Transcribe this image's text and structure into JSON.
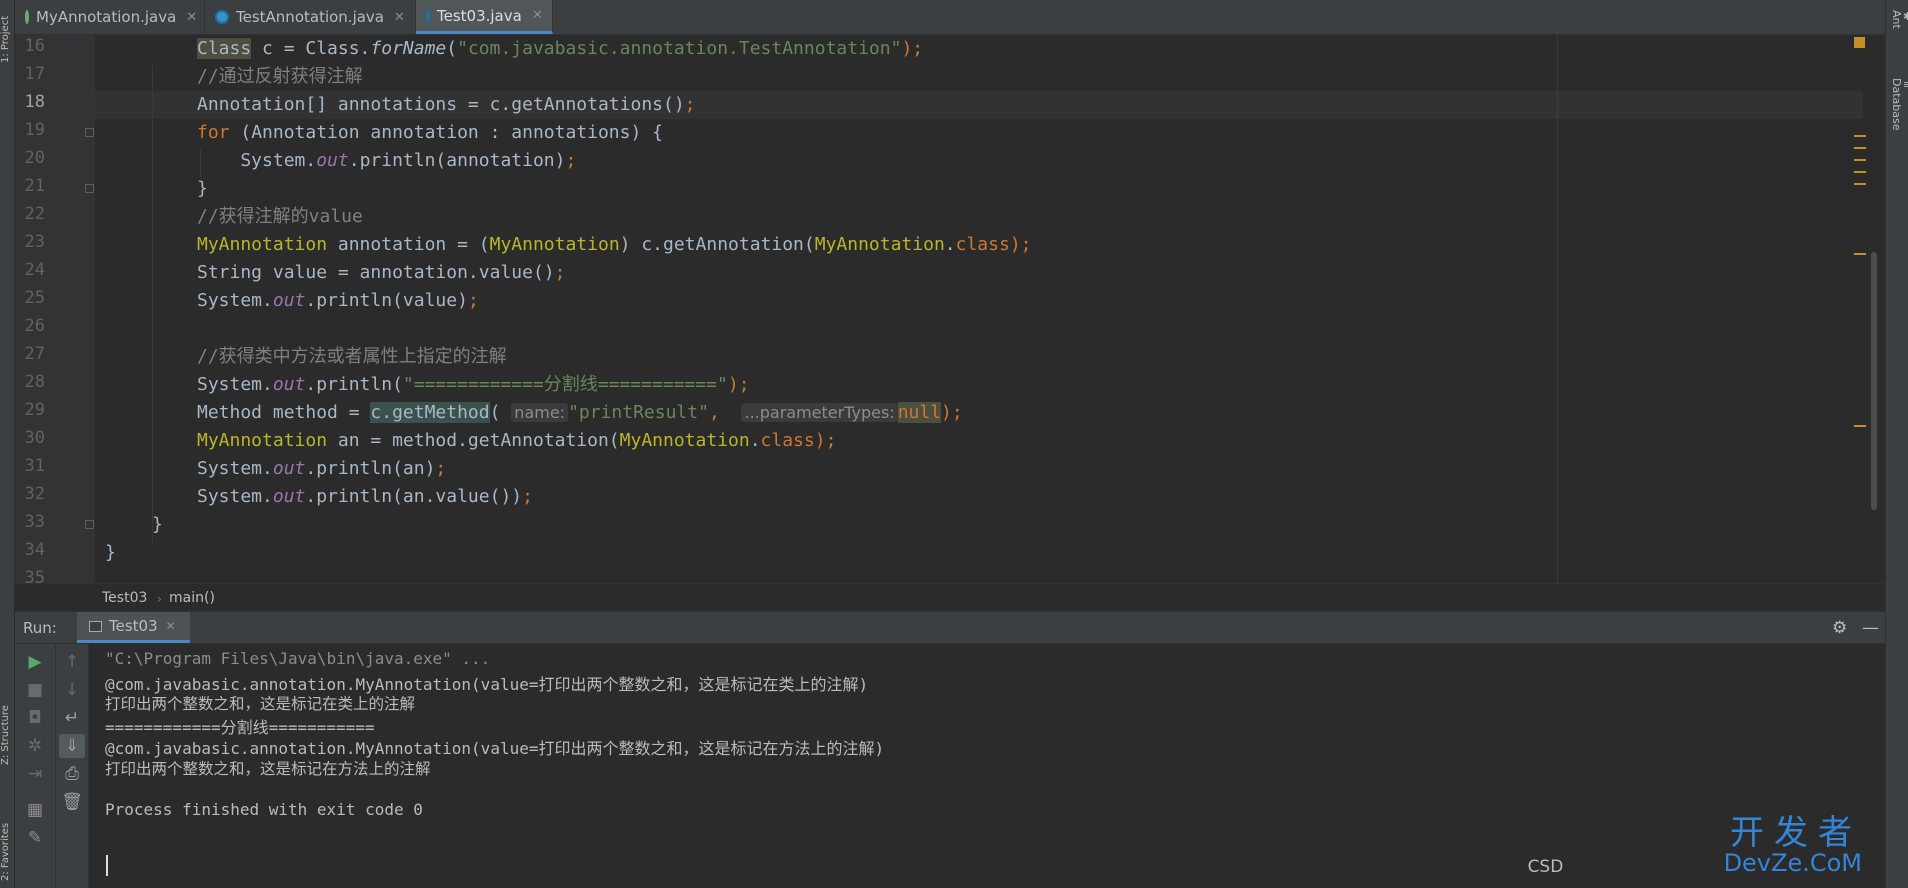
{
  "tool_windows": {
    "left": [
      "1: Project",
      "Z: Structure",
      "2: Favorites"
    ],
    "right": [
      "Ant",
      "Database"
    ]
  },
  "tabs": [
    {
      "label": "MyAnnotation.java",
      "icon": "annotation-file-icon",
      "active": false
    },
    {
      "label": "TestAnnotation.java",
      "icon": "class-file-icon",
      "active": false
    },
    {
      "label": "Test03.java",
      "icon": "class-file-icon",
      "active": true
    }
  ],
  "editor": {
    "line_numbers": [
      "16",
      "17",
      "18",
      "19",
      "20",
      "21",
      "22",
      "23",
      "24",
      "25",
      "26",
      "27",
      "28",
      "29",
      "30",
      "31",
      "32",
      "33",
      "34",
      "35"
    ],
    "current_line": "18",
    "lines": {
      "l16": {
        "a": "Class",
        "b": " c = Class.",
        "c": "forName",
        "d": "(",
        "e": "\"com.javabasic.annotation.TestAnnotation\"",
        "f": ");"
      },
      "l17": "//通过反射获得注解",
      "l18": {
        "a": "Annotation[] annotations = c.getAnnotations()",
        "b": ";"
      },
      "l19": {
        "a": "for",
        "b": " (Annotation annotation : annotations) {"
      },
      "l20": {
        "a": "    System.",
        "b": "out",
        "c": ".println(annotation)",
        "d": ";"
      },
      "l21": "}",
      "l22": "//获得注解的value",
      "l23": {
        "a": "MyAnnotation",
        "b": " annotation = (",
        "c": "MyAnnotation",
        "d": ") c.getAnnotation(",
        "e": "MyAnnotation",
        "f": ".",
        "g": "class",
        "h": ");"
      },
      "l24": {
        "a": "String value = annotation.value()",
        "b": ";"
      },
      "l25": {
        "a": "System.",
        "b": "out",
        "c": ".println(value)",
        "d": ";"
      },
      "l26": "",
      "l27": "//获得类中方法或者属性上指定的注解",
      "l28": {
        "a": "System.",
        "b": "out",
        "c": ".println(",
        "d": "\"============分割线===========\"",
        "e": ");"
      },
      "l29": {
        "a": "Method method = ",
        "b": "c.getMethod",
        "c": "(",
        "d": "name:",
        "e": "\"printResult\"",
        "f": ", ",
        "g": "...parameterTypes:",
        "h": "null",
        "i": ");"
      },
      "l30": {
        "a": "MyAnnotation",
        "b": " an = method.getAnnotation(",
        "c": "MyAnnotation",
        "d": ".",
        "e": "class",
        "f": ");"
      },
      "l31": {
        "a": "System.",
        "b": "out",
        "c": ".println(an)",
        "d": ";"
      },
      "l32": {
        "a": "System.",
        "b": "out",
        "c": ".println(an.value())",
        "d": ";"
      },
      "l33": "}",
      "l34": "}"
    }
  },
  "breadcrumb": {
    "class": "Test03",
    "method": "main()"
  },
  "run": {
    "label": "Run:",
    "tab_label": "Test03",
    "console": [
      "\"C:\\Program Files\\Java\\bin\\java.exe\" ...",
      "@com.javabasic.annotation.MyAnnotation(value=打印出两个整数之和，这是标记在类上的注解)",
      "打印出两个整数之和，这是标记在类上的注解",
      "============分割线===========",
      "@com.javabasic.annotation.MyAnnotation(value=打印出两个整数之和，这是标记在方法上的注解)",
      "打印出两个整数之和，这是标记在方法上的注解",
      "",
      "Process finished with exit code 0"
    ]
  },
  "watermark": {
    "big": "开发者",
    "small": "DevZe.CoM",
    "prefix": "CSD"
  },
  "colors": {
    "background": "#2b2b2b",
    "keyword": "#cc7832",
    "string": "#6a8759",
    "comment": "#808080",
    "annotation": "#bbb529",
    "field": "#9876aa",
    "accent": "#4a88c7"
  }
}
